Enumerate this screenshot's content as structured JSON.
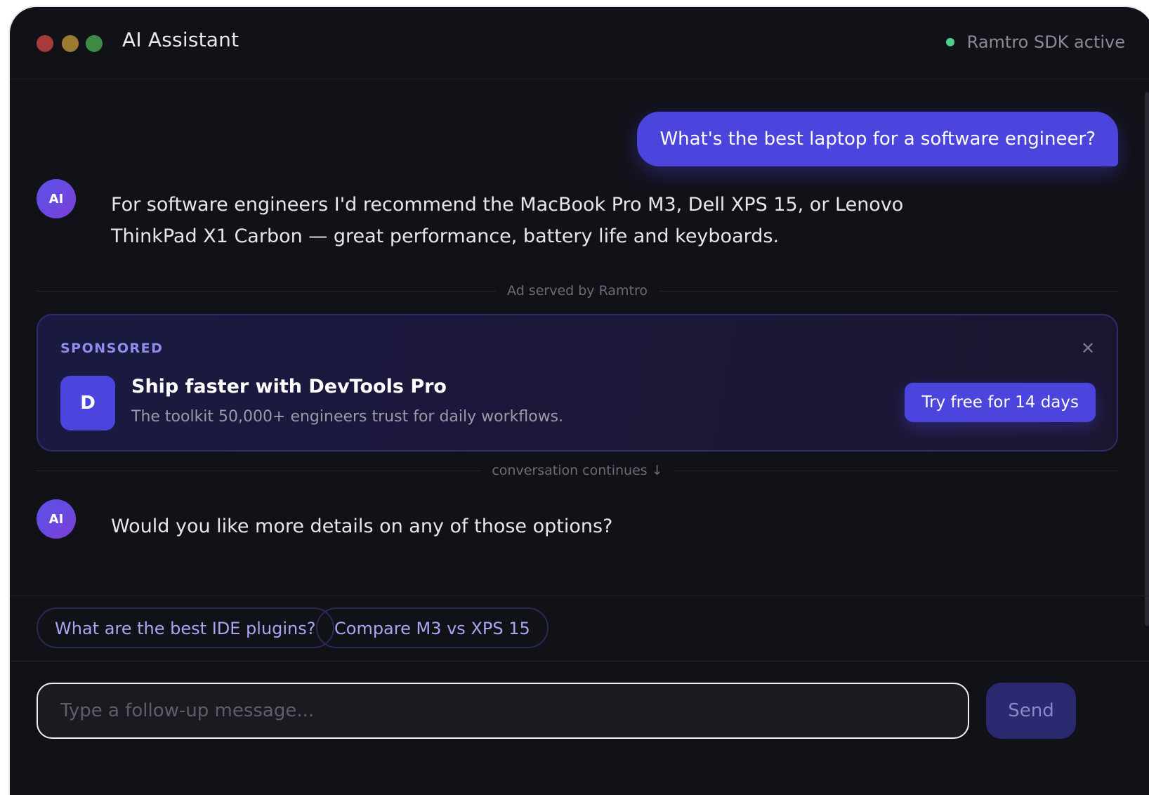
{
  "window": {
    "title": "AI Assistant",
    "traffic_lights": {
      "red": "#a63b3b",
      "yellow": "#9a7b30",
      "green": "#3e8a45"
    }
  },
  "status": {
    "text": "Ramtro SDK active",
    "color": "#4fd18b"
  },
  "theme": {
    "accent": "#4b45dd",
    "avatar_gradient_start": "#5a52e8",
    "avatar_gradient_end": "#7a3fd8",
    "sponsored_color": "#8f8cf0",
    "chip_text": "#a9a6f2"
  },
  "conversation": {
    "user_message": "What's the best laptop for a software engineer?",
    "ai_avatar_label": "AI",
    "ai_message_1_line1": "For software engineers I'd recommend the MacBook Pro M3, Dell XPS 15, or Lenovo",
    "ai_message_1_line2": "ThinkPad X1 Carbon — great performance, battery life and keyboards.",
    "ad_divider": "Ad served by Ramtro",
    "continue_divider": "conversation continues ↓",
    "ai_message_2": "Would you like more details on any of those options?"
  },
  "ad": {
    "tag": "SPONSORED",
    "logo_letter": "D",
    "title": "Ship faster with DevTools Pro",
    "description": "The toolkit 50,000+ engineers trust for daily workflows.",
    "cta": "Try free for 14 days",
    "close_icon": "close-icon"
  },
  "suggestions": [
    "What are the best IDE plugins?",
    "Compare M3 vs XPS 15"
  ],
  "composer": {
    "placeholder": "Type a follow-up message...",
    "value": "",
    "send_label": "Send",
    "send_bg": "#2b2970"
  }
}
